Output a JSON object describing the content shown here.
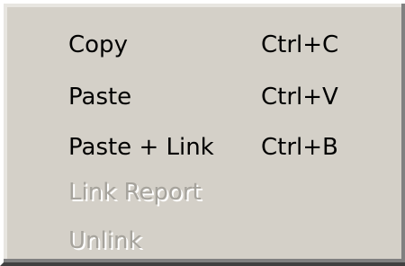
{
  "context_menu": {
    "items": [
      {
        "label": "Copy",
        "shortcut": "Ctrl+C",
        "enabled": true
      },
      {
        "label": "Paste",
        "shortcut": "Ctrl+V",
        "enabled": true
      },
      {
        "label": "Paste + Link",
        "shortcut": "Ctrl+B",
        "enabled": true
      },
      {
        "label": "Link Report",
        "shortcut": "",
        "enabled": false
      },
      {
        "label": "Unlink",
        "shortcut": "",
        "enabled": false
      }
    ],
    "colors": {
      "background": "#d4d0c8",
      "text": "#000000",
      "disabled_text": "#a6a39c",
      "highlight": "#ffffff",
      "shadow": "#404040"
    }
  }
}
